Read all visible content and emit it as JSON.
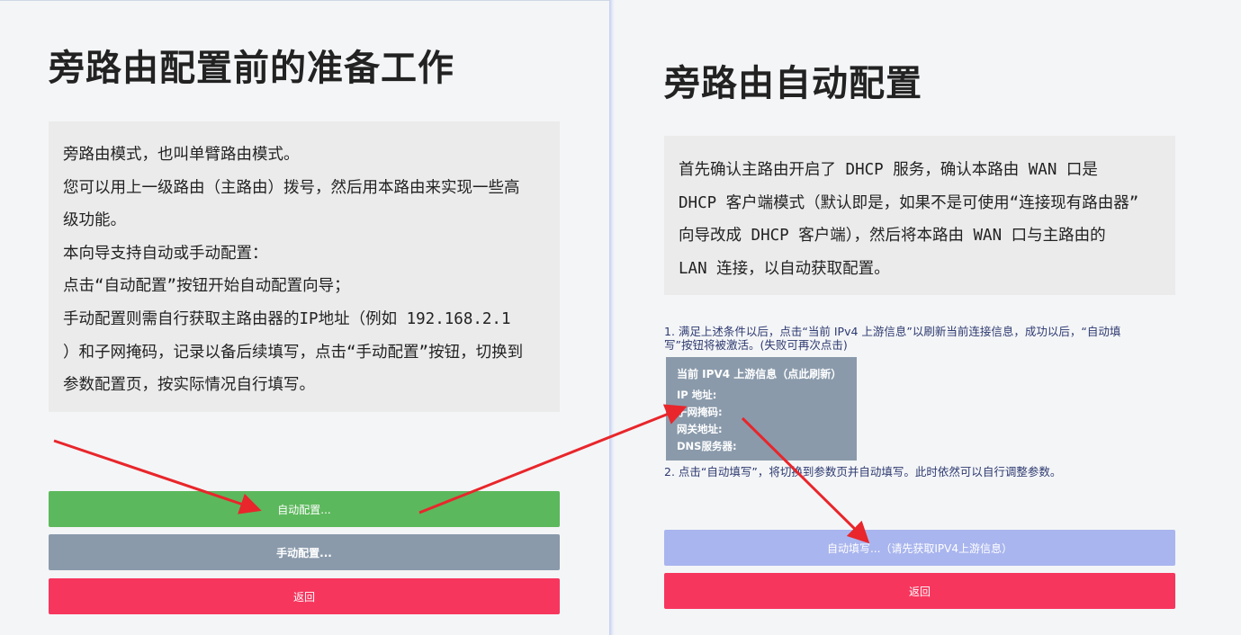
{
  "left": {
    "title": "旁路由配置前的准备工作",
    "desc_lines": [
      "旁路由模式，也叫单臂路由模式。",
      "您可以用上一级路由（主路由）拨号，然后用本路由来实现一些高",
      "级功能。",
      "本向导支持自动或手动配置：",
      "点击“自动配置”按钮开始自动配置向导；",
      "手动配置则需自行获取主路由器的IP地址（例如 192.168.2.1",
      "）和子网掩码，记录以备后续填写，点击“手动配置”按钮，切换到",
      "参数配置页，按实际情况自行填写。"
    ],
    "auto_button": "自动配置...",
    "manual_button": "手动配置...",
    "back_button": "返回"
  },
  "right": {
    "title": "旁路由自动配置",
    "desc_lines": [
      "首先确认主路由开启了 DHCP 服务，确认本路由 WAN 口是",
      "DHCP 客户端模式（默认即是，如果不是可使用“连接现有路由器”",
      "向导改成 DHCP 客户端），然后将本路由 WAN 口与主路由的",
      "LAN 连接，以自动获取配置。"
    ],
    "step1_lines": [
      "1. 满足上述条件以后，点击“当前 IPv4 上游信息”以刷新当前连接信息，成功以后，“自动填",
      "写”按钮将被激活。(失败可再次点击)"
    ],
    "upstream": {
      "title": "当前 IPV4 上游信息（点此刷新）",
      "ip_label": "IP 地址:",
      "mask_label": "子网掩码:",
      "gateway_label": "网关地址:",
      "dns_label": "DNS服务器:"
    },
    "step2": "2. 点击“自动填写”，将切换到参数页并自动填写。此时依然可以自行调整参数。",
    "autofill_button": "自动填写...（请先获取IPV4上游信息）",
    "back_button": "返回"
  },
  "colors": {
    "auto": "#5cb85c",
    "manual": "#8a9aab",
    "back": "#f7365e",
    "autofill_disabled": "#a9b5ee",
    "arrow": "#e8262b"
  }
}
